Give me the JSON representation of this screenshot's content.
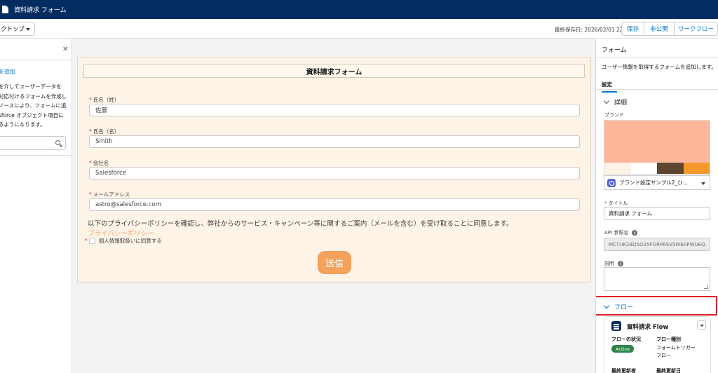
{
  "app": {
    "title": "資料請求 フォーム"
  },
  "toolbar": {
    "device": "クトップ",
    "last_saved": "最終保存日: 2026/02/01 22:32",
    "buttons": {
      "save": "保存",
      "unpublish": "非公開",
      "workflow": "ワークフロー"
    }
  },
  "left_panel": {
    "add_link": "を追加",
    "desc_lines": [
      "を介してユーザーデータを",
      "対応付けるフォームを作成し",
      "ノースにより、フォームに追",
      "sforce オブジェクト項目に",
      "るようになります。"
    ]
  },
  "form": {
    "title": "資料請求フォーム",
    "fields": [
      {
        "label": "氏名（姓）",
        "value": "佐藤"
      },
      {
        "label": "氏名（名）",
        "value": "Smith"
      },
      {
        "label": "会社名",
        "value": "Salesforce"
      },
      {
        "label": "メールアドレス",
        "value": "astro@salesforce.com"
      }
    ],
    "consent_text": "以下のプライバシーポリシーを確認し、弊社からのサービス・キャンペーン等に関するご案内（メールを含む）を受け取ることに同意します。",
    "privacy_link": "プライバシーポリシー",
    "agree_label": "個人情報取扱いに同意する",
    "submit": "送信",
    "required_mark": "*"
  },
  "right_panel": {
    "title": "フォーム",
    "description": "ユーザー情報を取得するフォームを追加します。",
    "tab": "設定",
    "details_section": "詳細",
    "brand_label": "ブランド",
    "brand_value": "ブランド設定サンプル2_ひ...",
    "brand_colors": {
      "main": "#ffb79c",
      "c1": "#fdf3e7",
      "c2": "#ffffff",
      "c3": "#5c4630",
      "c4": "#f49a2c"
    },
    "title_label": "タイトル",
    "title_value": "資料請求 フォーム",
    "api_label": "API 参照名",
    "api_value": "MCTUK2BQ5O35FORP6SVSW6APWUEQ",
    "desc_label": "説明",
    "flow_section": "フロー",
    "flow": {
      "name": "資料請求 Flow",
      "status_label": "フローの状況",
      "status": "Active",
      "type_label": "フロー種別",
      "type_line1": "フォームトリガー",
      "type_line2": "フロー",
      "updated_by_label": "最終更新者",
      "updated_date_label": "最終更新日"
    }
  }
}
